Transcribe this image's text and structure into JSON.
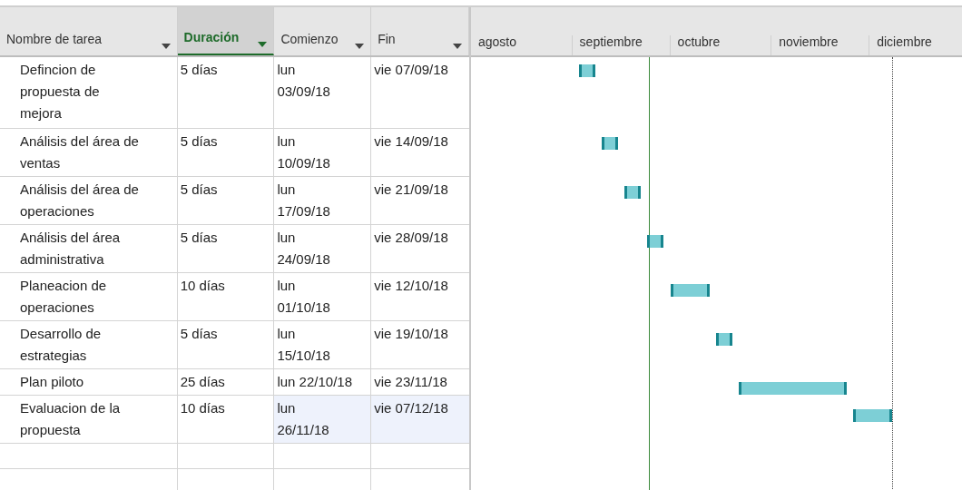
{
  "table": {
    "columns": [
      {
        "label": "Nombre de tarea",
        "selected": false
      },
      {
        "label": "Duración",
        "selected": true
      },
      {
        "label": "Comienzo",
        "selected": false
      },
      {
        "label": "Fin",
        "selected": false
      }
    ],
    "rows": [
      {
        "name": "Defincion de\npropuesta de\nmejora",
        "duration": "5 días",
        "start": "lun\n03/09/18",
        "end": "vie 07/09/18",
        "selected": false
      },
      {
        "name": "Análisis del área de\nventas",
        "duration": "5 días",
        "start": "lun\n10/09/18",
        "end": "vie 14/09/18",
        "selected": false
      },
      {
        "name": "Análisis del área de\noperaciones",
        "duration": "5 días",
        "start": "lun\n17/09/18",
        "end": "vie 21/09/18",
        "selected": false
      },
      {
        "name": "Análisis del área\nadministrativa",
        "duration": "5 días",
        "start": "lun\n24/09/18",
        "end": "vie 28/09/18",
        "selected": false
      },
      {
        "name": "Planeacion de\noperaciones",
        "duration": "10 días",
        "start": "lun\n01/10/18",
        "end": "vie 12/10/18",
        "selected": false
      },
      {
        "name": "Desarrollo de\nestrategias",
        "duration": "5 días",
        "start": "lun\n15/10/18",
        "end": "vie 19/10/18",
        "selected": false
      },
      {
        "name": "Plan piloto",
        "duration": "25 días",
        "start": "lun 22/10/18",
        "end": "vie 23/11/18",
        "selected": false
      },
      {
        "name": "Evaluacion de la\npropuesta",
        "duration": "10 días",
        "start": "lun\n26/11/18",
        "end": "vie 07/12/18",
        "selected": true
      }
    ]
  },
  "gantt": {
    "months": [
      "agosto",
      "septiembre",
      "octubre",
      "noviembre",
      "diciembre"
    ]
  }
}
